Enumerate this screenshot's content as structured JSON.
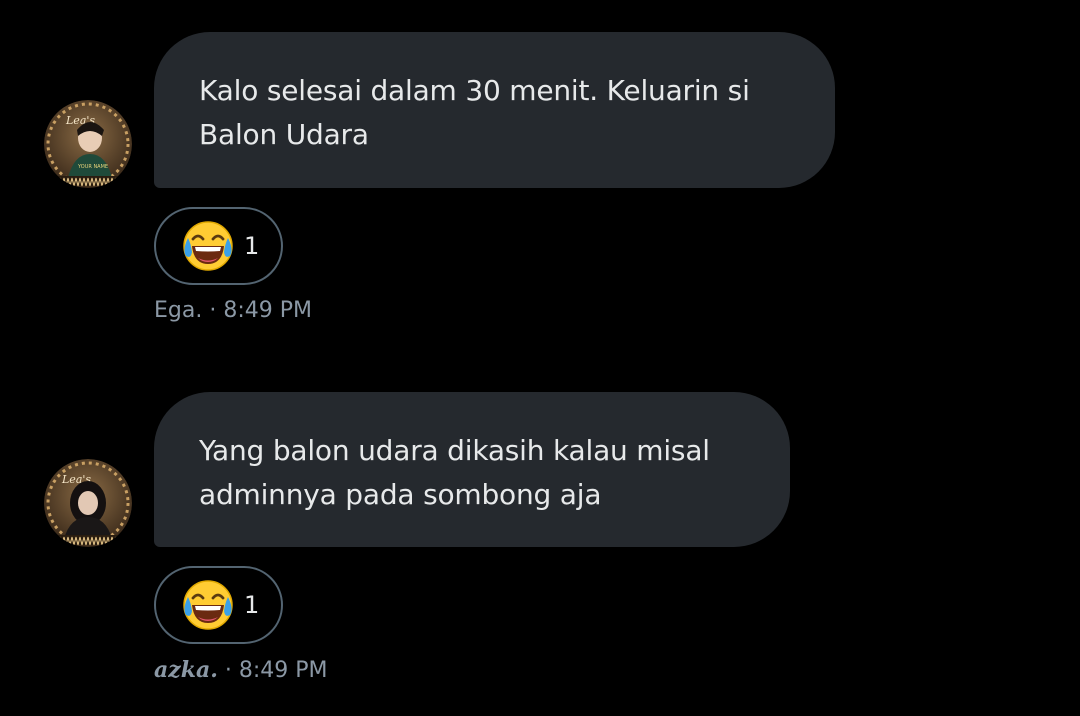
{
  "messages": [
    {
      "text": "Kalo selesai dalam 30 menit. Keluarin si\nBalon Udara",
      "reaction": {
        "emoji": "face-with-tears-of-joy",
        "count": "1"
      },
      "sender": "Ega.",
      "separator": " · ",
      "time": "8:49 PM"
    },
    {
      "text": "Yang balon udara dikasih kalau misal\nadminnya pada sombong aja",
      "reaction": {
        "emoji": "face-with-tears-of-joy",
        "count": "1"
      },
      "sender": "azka.",
      "separator": " · ",
      "time": "8:49 PM"
    }
  ],
  "colors": {
    "background": "#000000",
    "bubble": "#25292e",
    "text": "#e7e9ea",
    "meta": "#8b98a5",
    "reaction_border": "#536471"
  }
}
